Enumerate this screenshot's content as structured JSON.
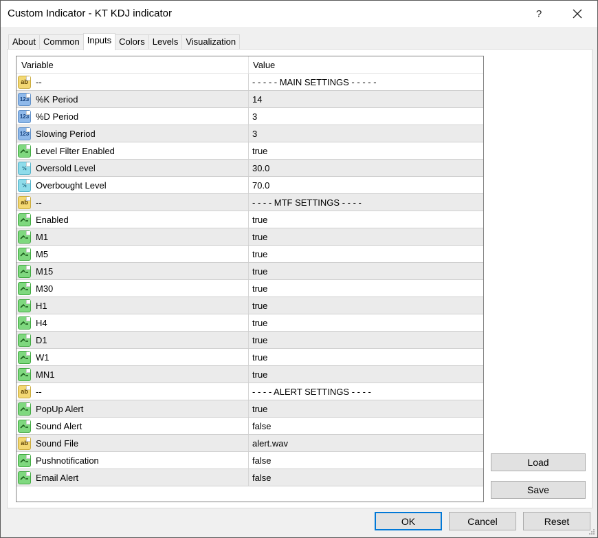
{
  "window": {
    "title": "Custom Indicator - KT KDJ indicator",
    "help_label": "?",
    "close_icon": "close-icon"
  },
  "tabs": [
    {
      "label": "About",
      "active": false
    },
    {
      "label": "Common",
      "active": false
    },
    {
      "label": "Inputs",
      "active": true
    },
    {
      "label": "Colors",
      "active": false
    },
    {
      "label": "Levels",
      "active": false
    },
    {
      "label": "Visualization",
      "active": false
    }
  ],
  "grid": {
    "headers": {
      "variable": "Variable",
      "value": "Value"
    },
    "rows": [
      {
        "type": "string",
        "icon": "ab",
        "variable": "--",
        "value": "- - - - - MAIN SETTINGS - - - - -"
      },
      {
        "type": "int",
        "icon": "123",
        "variable": "%K Period",
        "value": "14"
      },
      {
        "type": "int",
        "icon": "123",
        "variable": "%D Period",
        "value": "3"
      },
      {
        "type": "int",
        "icon": "123",
        "variable": "Slowing Period",
        "value": "3"
      },
      {
        "type": "bool",
        "icon": "bool",
        "variable": "Level Filter Enabled",
        "value": "true"
      },
      {
        "type": "double",
        "icon": "½",
        "variable": "Oversold Level",
        "value": "30.0"
      },
      {
        "type": "double",
        "icon": "½",
        "variable": "Overbought Level",
        "value": "70.0"
      },
      {
        "type": "string",
        "icon": "ab",
        "variable": "--",
        "value": "- - - - MTF SETTINGS - - - -"
      },
      {
        "type": "bool",
        "icon": "bool",
        "variable": "Enabled",
        "value": "true"
      },
      {
        "type": "bool",
        "icon": "bool",
        "variable": "M1",
        "value": "true"
      },
      {
        "type": "bool",
        "icon": "bool",
        "variable": "M5",
        "value": "true"
      },
      {
        "type": "bool",
        "icon": "bool",
        "variable": "M15",
        "value": "true"
      },
      {
        "type": "bool",
        "icon": "bool",
        "variable": "M30",
        "value": "true"
      },
      {
        "type": "bool",
        "icon": "bool",
        "variable": "H1",
        "value": "true"
      },
      {
        "type": "bool",
        "icon": "bool",
        "variable": "H4",
        "value": "true"
      },
      {
        "type": "bool",
        "icon": "bool",
        "variable": "D1",
        "value": "true"
      },
      {
        "type": "bool",
        "icon": "bool",
        "variable": "W1",
        "value": "true"
      },
      {
        "type": "bool",
        "icon": "bool",
        "variable": "MN1",
        "value": "true"
      },
      {
        "type": "string",
        "icon": "ab",
        "variable": "--",
        "value": "- - - - ALERT SETTINGS - - - -"
      },
      {
        "type": "bool",
        "icon": "bool",
        "variable": "PopUp Alert",
        "value": "true"
      },
      {
        "type": "bool",
        "icon": "bool",
        "variable": "Sound Alert",
        "value": "false"
      },
      {
        "type": "string",
        "icon": "ab",
        "variable": "Sound File",
        "value": "alert.wav"
      },
      {
        "type": "bool",
        "icon": "bool",
        "variable": "Pushnotification",
        "value": "false"
      },
      {
        "type": "bool",
        "icon": "bool",
        "variable": "Email Alert",
        "value": "false"
      }
    ]
  },
  "side_buttons": {
    "load": "Load",
    "save": "Save"
  },
  "footer": {
    "ok": "OK",
    "cancel": "Cancel",
    "reset": "Reset"
  },
  "colors": {
    "default_button_border": "#0078d7",
    "alt_row": "#ebebeb"
  }
}
